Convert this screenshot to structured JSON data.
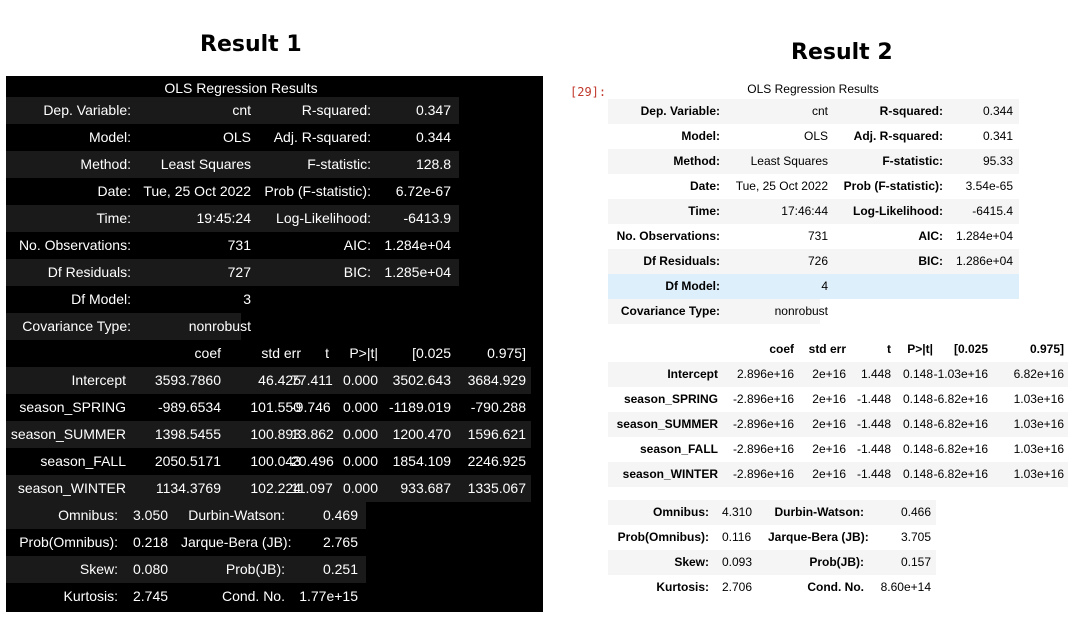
{
  "headings": {
    "result1": "Result 1",
    "result2": "Result 2"
  },
  "cell_prompt": "[29]:",
  "r1": {
    "caption": "OLS Regression Results",
    "summary": [
      [
        "Dep. Variable:",
        "cnt",
        "R-squared:",
        "0.347"
      ],
      [
        "Model:",
        "OLS",
        "Adj. R-squared:",
        "0.344"
      ],
      [
        "Method:",
        "Least Squares",
        "F-statistic:",
        "128.8"
      ],
      [
        "Date:",
        "Tue, 25 Oct 2022",
        "Prob (F-statistic):",
        "6.72e-67"
      ],
      [
        "Time:",
        "19:45:24",
        "Log-Likelihood:",
        "-6413.9"
      ],
      [
        "No. Observations:",
        "731",
        "AIC:",
        "1.284e+04"
      ],
      [
        "Df Residuals:",
        "727",
        "BIC:",
        "1.285e+04"
      ],
      [
        "Df Model:",
        "3",
        "",
        ""
      ],
      [
        "Covariance Type:",
        "nonrobust",
        "",
        ""
      ]
    ],
    "coef_header": [
      "",
      "coef",
      "std err",
      "t",
      "P>|t|",
      "[0.025",
      "0.975]"
    ],
    "coef_rows": [
      [
        "Intercept",
        "3593.7860",
        "46.425",
        "77.411",
        "0.000",
        "3502.643",
        "3684.929"
      ],
      [
        "season_SPRING",
        "-989.6534",
        "101.550",
        "-9.746",
        "0.000",
        "-1189.019",
        "-790.288"
      ],
      [
        "season_SUMMER",
        "1398.5455",
        "100.893",
        "13.862",
        "0.000",
        "1200.470",
        "1596.621"
      ],
      [
        "season_FALL",
        "2050.5171",
        "100.043",
        "20.496",
        "0.000",
        "1854.109",
        "2246.925"
      ],
      [
        "season_WINTER",
        "1134.3769",
        "102.224",
        "11.097",
        "0.000",
        "933.687",
        "1335.067"
      ]
    ],
    "diag": [
      [
        "Omnibus:",
        "3.050",
        "Durbin-Watson:",
        "0.469"
      ],
      [
        "Prob(Omnibus):",
        "0.218",
        "Jarque-Bera (JB):",
        "2.765"
      ],
      [
        "Skew:",
        "0.080",
        "Prob(JB):",
        "0.251"
      ],
      [
        "Kurtosis:",
        "2.745",
        "Cond. No.",
        "1.77e+15"
      ]
    ]
  },
  "r2": {
    "caption": "OLS Regression Results",
    "summary": [
      [
        "Dep. Variable:",
        "cnt",
        "R-squared:",
        "0.344"
      ],
      [
        "Model:",
        "OLS",
        "Adj. R-squared:",
        "0.341"
      ],
      [
        "Method:",
        "Least Squares",
        "F-statistic:",
        "95.33"
      ],
      [
        "Date:",
        "Tue, 25 Oct 2022",
        "Prob (F-statistic):",
        "3.54e-65"
      ],
      [
        "Time:",
        "17:46:44",
        "Log-Likelihood:",
        "-6415.4"
      ],
      [
        "No. Observations:",
        "731",
        "AIC:",
        "1.284e+04"
      ],
      [
        "Df Residuals:",
        "726",
        "BIC:",
        "1.286e+04"
      ],
      [
        "Df Model:",
        "4",
        "",
        ""
      ],
      [
        "Covariance Type:",
        "nonrobust",
        "",
        ""
      ]
    ],
    "coef_header": [
      "",
      "coef",
      "std err",
      "t",
      "P>|t|",
      "[0.025",
      "0.975]"
    ],
    "coef_rows": [
      [
        "Intercept",
        "2.896e+16",
        "2e+16",
        "1.448",
        "0.148",
        "-1.03e+16",
        "6.82e+16"
      ],
      [
        "season_SPRING",
        "-2.896e+16",
        "2e+16",
        "-1.448",
        "0.148",
        "-6.82e+16",
        "1.03e+16"
      ],
      [
        "season_SUMMER",
        "-2.896e+16",
        "2e+16",
        "-1.448",
        "0.148",
        "-6.82e+16",
        "1.03e+16"
      ],
      [
        "season_FALL",
        "-2.896e+16",
        "2e+16",
        "-1.448",
        "0.148",
        "-6.82e+16",
        "1.03e+16"
      ],
      [
        "season_WINTER",
        "-2.896e+16",
        "2e+16",
        "-1.448",
        "0.148",
        "-6.82e+16",
        "1.03e+16"
      ]
    ],
    "diag": [
      [
        "Omnibus:",
        "4.310",
        "Durbin-Watson:",
        "0.466"
      ],
      [
        "Prob(Omnibus):",
        "0.116",
        "Jarque-Bera (JB):",
        "3.705"
      ],
      [
        "Skew:",
        "0.093",
        "Prob(JB):",
        "0.157"
      ],
      [
        "Kurtosis:",
        "2.706",
        "Cond. No.",
        "8.60e+14"
      ]
    ]
  }
}
